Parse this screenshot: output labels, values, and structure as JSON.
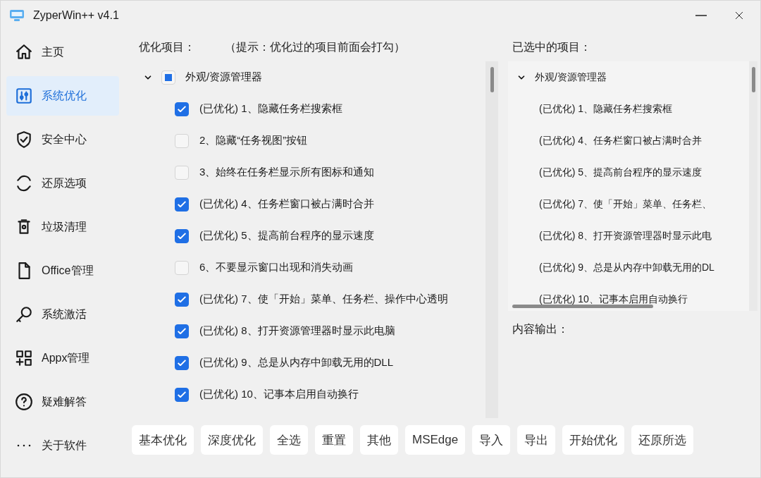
{
  "window": {
    "title": "ZyperWin++ v4.1"
  },
  "sidebar": {
    "items": [
      {
        "label": "主页",
        "selected": false
      },
      {
        "label": "系统优化",
        "selected": true
      },
      {
        "label": "安全中心",
        "selected": false
      },
      {
        "label": "还原选项",
        "selected": false
      },
      {
        "label": "垃圾清理",
        "selected": false
      },
      {
        "label": "Office管理",
        "selected": false
      },
      {
        "label": "系统激活",
        "selected": false
      },
      {
        "label": "Appx管理",
        "selected": false
      },
      {
        "label": "疑难解答",
        "selected": false
      },
      {
        "label": "关于软件",
        "selected": false
      }
    ]
  },
  "options": {
    "heading": "优化项目：",
    "hint": "（提示：优化过的项目前面会打勾）",
    "groups": [
      {
        "label": "外观/资源管理器",
        "expanded": true,
        "indeterminate": true,
        "items": [
          {
            "label": "(已优化) 1、隐藏任务栏搜索框",
            "checked": true
          },
          {
            "label": "2、隐藏“任务视图”按钮",
            "checked": false
          },
          {
            "label": "3、始终在任务栏显示所有图标和通知",
            "checked": false
          },
          {
            "label": "(已优化) 4、任务栏窗口被占满时合并",
            "checked": true
          },
          {
            "label": "(已优化) 5、提高前台程序的显示速度",
            "checked": true
          },
          {
            "label": "6、不要显示窗口出现和消失动画",
            "checked": false
          },
          {
            "label": "(已优化) 7、使「开始」菜单、任务栏、操作中心透明",
            "checked": true
          },
          {
            "label": "(已优化) 8、打开资源管理器时显示此电脑",
            "checked": true
          },
          {
            "label": "(已优化) 9、总是从内存中卸载无用的DLL",
            "checked": true
          },
          {
            "label": "(已优化) 10、记事本启用自动换行",
            "checked": true
          }
        ]
      }
    ]
  },
  "selected_items": {
    "heading": "已选中的项目：",
    "groups": [
      {
        "label": "外观/资源管理器",
        "expanded": true,
        "items": [
          "(已优化) 1、隐藏任务栏搜索框",
          "(已优化) 4、任务栏窗口被占满时合并",
          "(已优化) 5、提高前台程序的显示速度",
          "(已优化) 7、使「开始」菜单、任务栏、",
          "(已优化) 8、打开资源管理器时显示此电",
          "(已优化) 9、总是从内存中卸载无用的DL",
          "(已优化) 10、记事本启用自动换行"
        ]
      }
    ]
  },
  "output": {
    "heading": "内容输出："
  },
  "buttons": [
    "基本优化",
    "深度优化",
    "全选",
    "重置",
    "其他",
    "MSEdge",
    "导入",
    "导出",
    "开始优化",
    "还原所选"
  ]
}
